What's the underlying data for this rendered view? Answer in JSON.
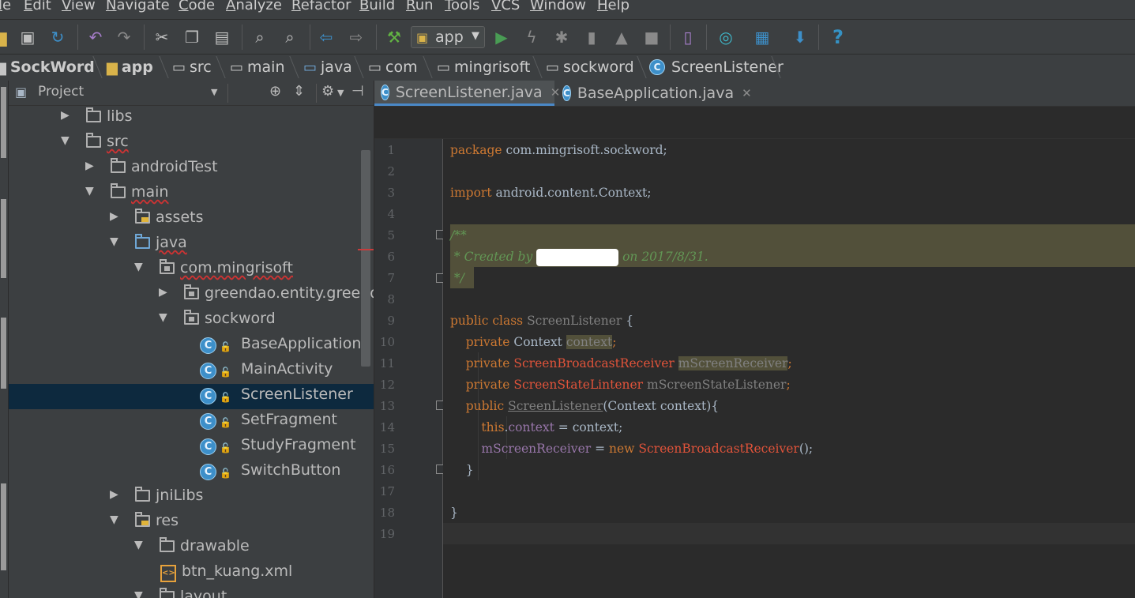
{
  "menu": {
    "items": [
      "le",
      "Edit",
      "View",
      "Navigate",
      "Code",
      "Analyze",
      "Refactor",
      "Build",
      "Run",
      "Tools",
      "VCS",
      "Window",
      "Help"
    ]
  },
  "toolbar": {
    "run_config": "app",
    "help_icon": "?",
    "icons": [
      "open-icon",
      "save-icon",
      "sync-icon",
      "undo-icon",
      "redo-icon",
      "cut-icon",
      "copy-icon",
      "paste-icon",
      "find-icon",
      "replace-icon",
      "back-icon",
      "forward-icon",
      "make-icon",
      "run-icon",
      "apply-changes-icon",
      "debug-icon",
      "profile-icon",
      "attach-debugger-icon",
      "stop-icon",
      "avd-manager-icon",
      "sync-gradle-icon",
      "project-structure-icon",
      "sdk-manager-icon",
      "help-icon"
    ],
    "colors": {
      "run": "#499c54",
      "hammer": "#62b543",
      "undo": "#a57dc9",
      "nav": "#3d8fc9",
      "help": "#3592c4"
    }
  },
  "breadcrumb": [
    {
      "label": "SockWord",
      "icon": "project-folder-icon"
    },
    {
      "label": "app",
      "icon": "module-folder-icon"
    },
    {
      "label": "src",
      "icon": "folder-icon"
    },
    {
      "label": "main",
      "icon": "folder-icon"
    },
    {
      "label": "java",
      "icon": "source-folder-icon"
    },
    {
      "label": "com",
      "icon": "package-icon"
    },
    {
      "label": "mingrisoft",
      "icon": "package-icon"
    },
    {
      "label": "sockword",
      "icon": "package-icon"
    },
    {
      "label": "ScreenListener",
      "icon": "class-icon"
    }
  ],
  "project_panel": {
    "title": "Project",
    "tree": [
      {
        "label": "libs",
        "arrow": "▶",
        "type": "folder",
        "level": 0
      },
      {
        "label": "src",
        "arrow": "▼",
        "type": "folder",
        "level": 0
      },
      {
        "label": "androidTest",
        "arrow": "▶",
        "type": "folder",
        "level": 1
      },
      {
        "label": "main",
        "arrow": "▼",
        "type": "folder",
        "level": 1
      },
      {
        "label": "assets",
        "arrow": "▶",
        "type": "assets",
        "level": 2
      },
      {
        "label": "java",
        "arrow": "▼",
        "type": "src",
        "level": 2
      },
      {
        "label": "com.mingrisoft",
        "arrow": "▼",
        "type": "pkg",
        "level": 3
      },
      {
        "label": "greendao.entity.greenda",
        "arrow": "▶",
        "type": "pkg",
        "level": 4
      },
      {
        "label": "sockword",
        "arrow": "▼",
        "type": "pkg",
        "level": 4
      },
      {
        "label": "BaseApplication",
        "arrow": "",
        "type": "class",
        "level": 5
      },
      {
        "label": "MainActivity",
        "arrow": "",
        "type": "class",
        "level": 5
      },
      {
        "label": "ScreenListener",
        "arrow": "",
        "type": "class",
        "level": 5,
        "selected": true
      },
      {
        "label": "SetFragment",
        "arrow": "",
        "type": "class",
        "level": 5
      },
      {
        "label": "StudyFragment",
        "arrow": "",
        "type": "class",
        "level": 5
      },
      {
        "label": "SwitchButton",
        "arrow": "",
        "type": "class",
        "level": 5
      },
      {
        "label": "jniLibs",
        "arrow": "▶",
        "type": "folder",
        "level": 2
      },
      {
        "label": "res",
        "arrow": "▼",
        "type": "res",
        "level": 2
      },
      {
        "label": "drawable",
        "arrow": "▼",
        "type": "folder",
        "level": 3
      },
      {
        "label": "btn_kuang.xml",
        "arrow": "",
        "type": "xml",
        "level": 4
      },
      {
        "label": "layout",
        "arrow": "▼",
        "type": "folder",
        "level": 3
      }
    ]
  },
  "editor": {
    "tabs": [
      {
        "label": "ScreenListener.java",
        "active": true
      },
      {
        "label": "BaseApplication.java",
        "active": false
      }
    ],
    "line_numbers": [
      "1",
      "2",
      "3",
      "4",
      "5",
      "6",
      "7",
      "8",
      "9",
      "10",
      "11",
      "12",
      "13",
      "14",
      "15",
      "16",
      "17",
      "18",
      "19"
    ],
    "code": {
      "l1_kw": "package",
      "l1_rest": " com.mingrisoft.sockword;",
      "l3_kw": "import",
      "l3_rest": " android.content.Context;",
      "l5": "/**",
      "l6_a": " * Created by ",
      "l6_b": " on 2017/8/31.",
      "l7": " */",
      "l9_kw": "public class",
      "l9_name": " ScreenListener",
      "l9_rest": " {",
      "l10_kw": "private",
      "l10_type": " Context ",
      "l10_field": "context",
      "l10_end": ";",
      "l11_kw": "private",
      "l11_type": "ScreenBroadcastReceiver",
      "l11_field": "mScreenReceiver",
      "l11_end": ";",
      "l12_kw": "private",
      "l12_type": "ScreenStateLintener",
      "l12_field": "mScreenStateListener",
      "l12_end": ";",
      "l13_kw": "public",
      "l13_name": "ScreenListener",
      "l13_rest": "(Context context){",
      "l14_kw": "this",
      "l14_field": "context",
      "l14_rest": " = context;",
      "l15_field": "mScreenReceiver",
      "l15_eq": " = ",
      "l15_kw": "new",
      "l15_type": "ScreenBroadcastReceiver",
      "l15_rest": "();",
      "l16": "}",
      "l18": "}"
    }
  }
}
